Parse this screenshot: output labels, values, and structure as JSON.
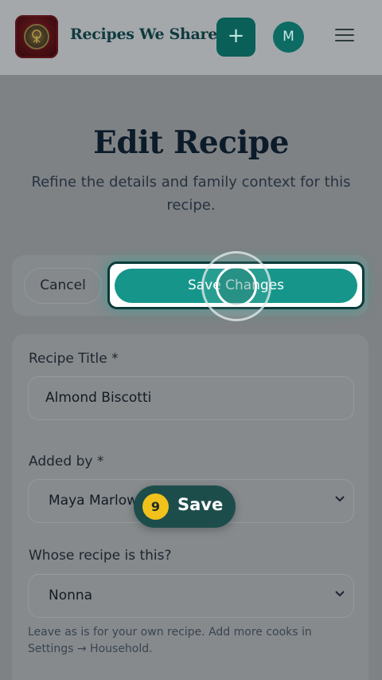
{
  "header": {
    "brand": "Recipes We Share",
    "add_label": "+",
    "avatar_initial": "M"
  },
  "page": {
    "title": "Edit Recipe",
    "subtitle": "Refine the details and family context for this recipe."
  },
  "actions": {
    "cancel_label": "Cancel",
    "save_label": "Save Changes"
  },
  "form": {
    "title_label": "Recipe Title *",
    "title_value": "Almond Biscotti",
    "added_by_label": "Added by *",
    "added_by_value": "Maya Marlow",
    "whose_label": "Whose recipe is this?",
    "whose_value": "Nonna",
    "help_text": "Leave as is for your own recipe. Add more cooks in Settings → Household."
  },
  "step": {
    "number": "9",
    "label": "Save"
  },
  "colors": {
    "accent": "#16968a",
    "step_badge": "#f1c21b"
  },
  "icons": [
    "logo-emblem",
    "plus-icon",
    "hamburger-menu-icon",
    "chevron-down-icon"
  ]
}
